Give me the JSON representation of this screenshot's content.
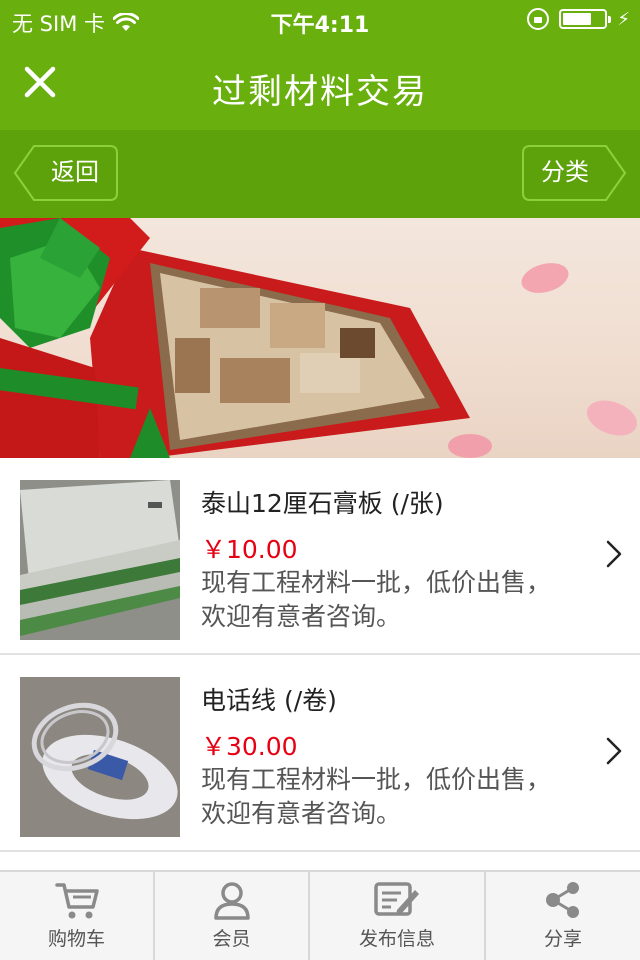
{
  "status_bar": {
    "carrier": "无 SIM 卡",
    "time": "下午4:11",
    "battery_level": 0.7
  },
  "header": {
    "title": "过剩材料交易",
    "close_icon": "close-icon"
  },
  "subnav": {
    "back_label": "返回",
    "category_label": "分类"
  },
  "products": [
    {
      "title": "泰山12厘石膏板 (/张)",
      "price": "￥10.00",
      "desc": "现有工程材料一批，低价出售，欢迎有意者咨询。"
    },
    {
      "title": "电话线 (/卷)",
      "price": "￥30.00",
      "desc": "现有工程材料一批，低价出售，欢迎有意者咨询。"
    }
  ],
  "tabs": [
    {
      "label": "购物车",
      "icon": "cart-icon"
    },
    {
      "label": "会员",
      "icon": "user-icon"
    },
    {
      "label": "发布信息",
      "icon": "edit-icon"
    },
    {
      "label": "分享",
      "icon": "share-icon"
    }
  ],
  "colors": {
    "brand_green": "#69b00f",
    "subnav_green": "#5da20a",
    "price_red": "#e60012"
  }
}
